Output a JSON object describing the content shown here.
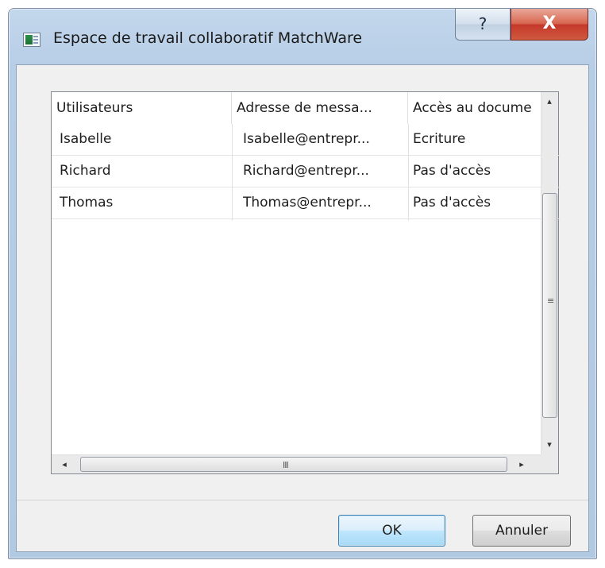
{
  "window": {
    "title": "Espace de travail collaboratif MatchWare",
    "help_glyph": "?",
    "close_glyph": "X",
    "icon": "matchware-app-icon"
  },
  "list": {
    "columns": [
      "Utilisateurs",
      "Adresse de messa...",
      "Accès au docume"
    ],
    "rows": [
      [
        "Isabelle",
        "Isabelle@entrepr...",
        "Ecriture"
      ],
      [
        "Richard",
        "Richard@entrepr...",
        "Pas d'accès"
      ],
      [
        "Thomas",
        "Thomas@entrepr...",
        "Pas d'accès"
      ]
    ],
    "scroll": {
      "up_glyph": "▴",
      "down_glyph": "▾",
      "left_glyph": "◂",
      "right_glyph": "▸",
      "vgrip": "≡",
      "hgrip": "III"
    }
  },
  "buttons": {
    "ok": "OK",
    "cancel": "Annuler"
  },
  "colors": {
    "frame": "#b6cde6",
    "close": "#c4382a",
    "default_button_border": "#3c7fb1"
  }
}
